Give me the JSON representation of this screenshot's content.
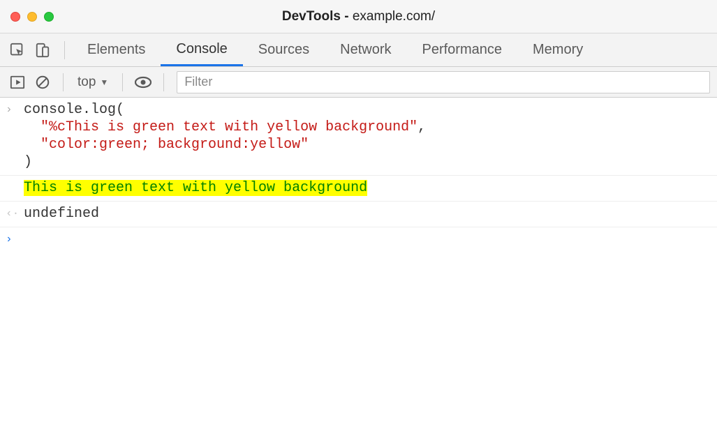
{
  "window": {
    "title_prefix": "DevTools - ",
    "title_host": "example.com/"
  },
  "tabs": [
    {
      "label": "Elements",
      "active": false
    },
    {
      "label": "Console",
      "active": true
    },
    {
      "label": "Sources",
      "active": false
    },
    {
      "label": "Network",
      "active": false
    },
    {
      "label": "Performance",
      "active": false
    },
    {
      "label": "Memory",
      "active": false
    }
  ],
  "console_toolbar": {
    "context_label": "top",
    "filter_placeholder": "Filter"
  },
  "console_rows": {
    "input_code": {
      "fn": "console.log",
      "open": "(",
      "arg1": "\"%cThis is green text with yellow background\"",
      "comma": ",",
      "arg2": "\"color:green; background:yellow\"",
      "close": ")"
    },
    "output_text": "This is green text with yellow background",
    "return_value": "undefined"
  }
}
